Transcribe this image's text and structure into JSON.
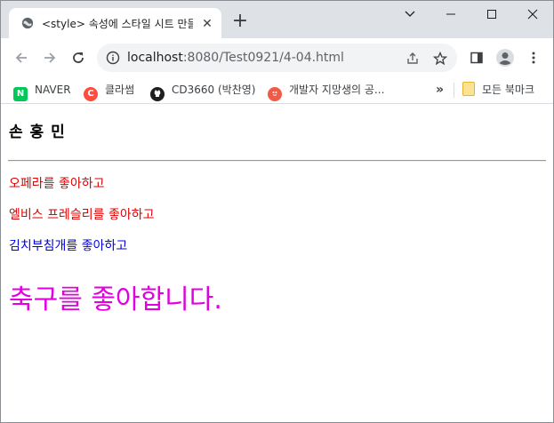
{
  "browser": {
    "tab_title": "<style> 속성에 스타일 시트 만들기",
    "url_host": "localhost",
    "url_rest": ":8080/Test0921/4-04.html",
    "bookmarks": [
      {
        "label": "NAVER",
        "icon": "naver-icon",
        "icon_text": "N",
        "color": "#03c75a"
      },
      {
        "label": "클라썸",
        "icon": "classum-icon",
        "icon_text": "C",
        "color": "#ff4d3d"
      },
      {
        "label": "CD3660 (박찬영)",
        "icon": "github-icon",
        "icon_text": "",
        "color": "#1f1f1f"
      },
      {
        "label": "개발자 지망생의 공...",
        "icon": "blog-icon",
        "icon_text": "",
        "color": "#ef5b46"
      }
    ],
    "overflow_label": "»",
    "all_bookmarks_label": "모든 북마크"
  },
  "page": {
    "name": "손 홍 민",
    "lines": [
      {
        "text": "오페라를 좋아하고",
        "color": "#e00000"
      },
      {
        "text": "엘비스 프레슬리를 좋아하고",
        "color": "#e00000"
      },
      {
        "text": "김치부침개를 좋아하고",
        "color": "#0000e0"
      }
    ],
    "big_text": "축구를 좋아합니다.",
    "big_color": "#e000e0"
  }
}
